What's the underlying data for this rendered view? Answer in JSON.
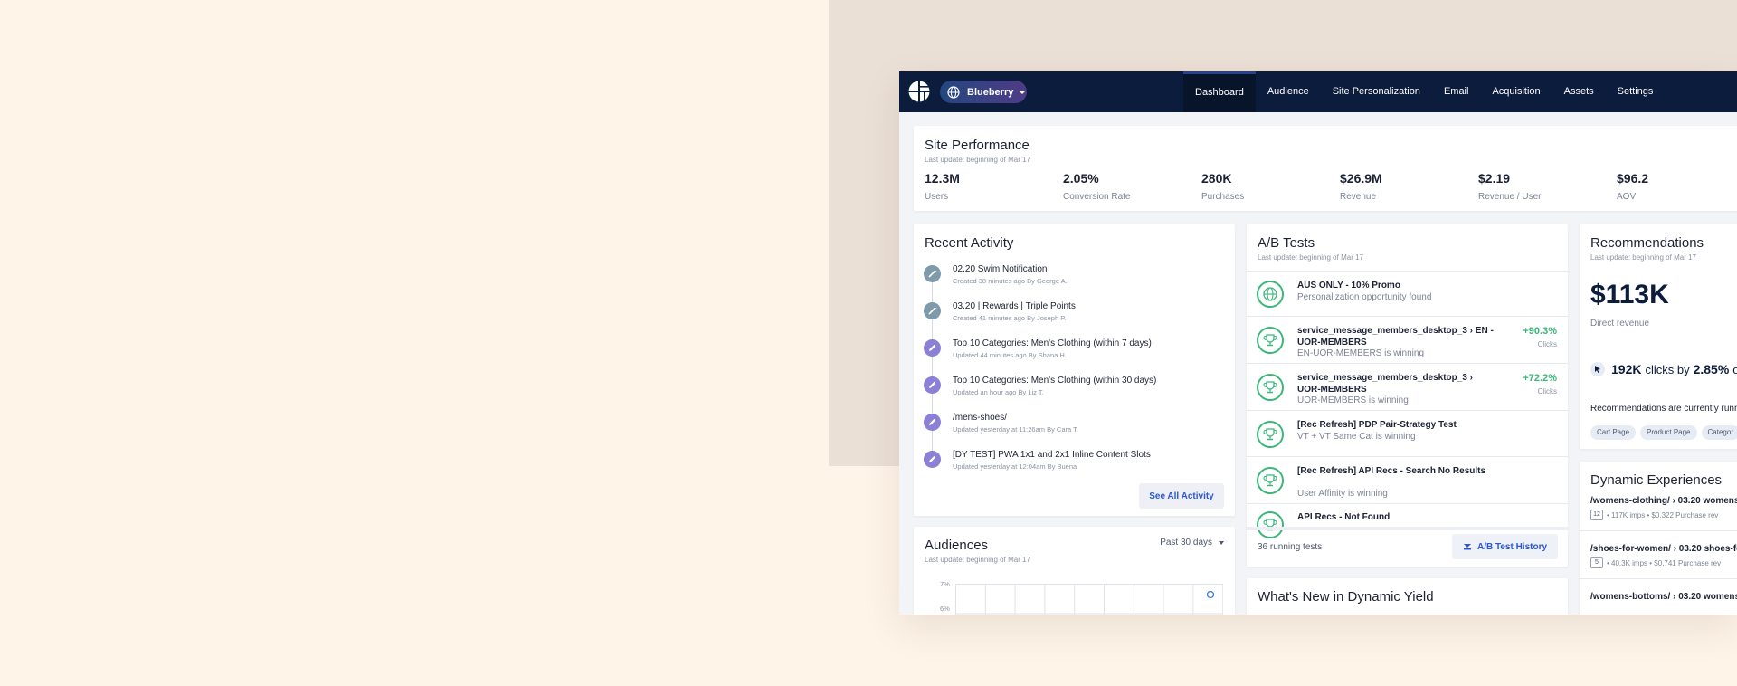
{
  "site": {
    "name": "Blueberry"
  },
  "nav": {
    "tabs": [
      "Dashboard",
      "Audience",
      "Site Personalization",
      "Email",
      "Acquisition",
      "Assets",
      "Settings"
    ],
    "active": "Dashboard"
  },
  "site_performance": {
    "title": "Site Performance",
    "updated": "Last update: beginning of Mar 17",
    "metrics": [
      {
        "value": "12.3M",
        "label": "Users"
      },
      {
        "value": "2.05%",
        "label": "Conversion Rate"
      },
      {
        "value": "280K",
        "label": "Purchases"
      },
      {
        "value": "$26.9M",
        "label": "Revenue"
      },
      {
        "value": "$2.19",
        "label": "Revenue / User"
      },
      {
        "value": "$96.2",
        "label": "AOV"
      }
    ]
  },
  "recent_activity": {
    "title": "Recent Activity",
    "items": [
      {
        "title": "02.20 Swim Notification",
        "meta": "Created 38 minutes ago By George A.",
        "kind": "created"
      },
      {
        "title": "03.20 | Rewards | Triple Points",
        "meta": "Created 41 minutes ago By Joseph P.",
        "kind": "created"
      },
      {
        "title": "Top 10 Categories: Men's Clothing (within 7 days)",
        "meta": "Updated 44 minutes ago By Shana H.",
        "kind": "updated"
      },
      {
        "title": "Top 10 Categories: Men's Clothing (within 30 days)",
        "meta": "Updated an hour ago By Liz T.",
        "kind": "updated"
      },
      {
        "title": "/mens-shoes/",
        "meta": "Updated yesterday at 11:26am By Cara T.",
        "kind": "updated"
      },
      {
        "title": "[DY TEST] PWA 1x1 and 2x1 Inline Content Slots",
        "meta": "Updated yesterday at 12:04am By Buena",
        "kind": "updated"
      }
    ],
    "see_all": "See All Activity",
    "colors": {
      "created": "#7f9aaa",
      "updated": "#8b7fd6"
    }
  },
  "audiences": {
    "title": "Audiences",
    "updated": "Last update: beginning of Mar 17",
    "range": "Past 30 days",
    "yticks": [
      "7%",
      "6%"
    ]
  },
  "ab_tests": {
    "title": "A/B Tests",
    "updated": "Last update: beginning of Mar 17",
    "items": [
      {
        "title": "AUS ONLY - 10% Promo",
        "status": "Personalization opportunity found",
        "pct": "",
        "metric": "",
        "icon": "globe-icon"
      },
      {
        "title": "service_message_members_desktop_3 › EN - UOR-MEMBERS",
        "status": "EN-UOR-MEMBERS is winning",
        "pct": "+90.3%",
        "metric": "Clicks",
        "icon": "trophy-icon"
      },
      {
        "title": "service_message_members_desktop_3 › UOR-MEMBERS",
        "status": "UOR-MEMBERS is winning",
        "pct": "+72.2%",
        "metric": "Clicks",
        "icon": "trophy-icon"
      },
      {
        "title": "[Rec Refresh] PDP Pair-Strategy Test",
        "status": "VT + VT Same Cat is winning",
        "pct": "",
        "metric": "",
        "icon": "trophy-icon"
      },
      {
        "title": "[Rec Refresh] API Recs - Search No Results",
        "status": "User Affinity is winning",
        "pct": "",
        "metric": "",
        "icon": "trophy-icon"
      },
      {
        "title": "API Recs - Not Found",
        "status": "",
        "pct": "",
        "metric": "",
        "icon": "trophy-icon"
      }
    ],
    "running": "36 running tests",
    "history_btn": "A/B Test History"
  },
  "whats_new": {
    "title": "What's New in Dynamic Yield"
  },
  "recommendations": {
    "title": "Recommendations",
    "updated": "Last update: beginning of Mar 17",
    "revenue": "$113K",
    "revenue_label": "Direct revenue",
    "clicks_value": "192K",
    "clicks_word": "clicks by",
    "clicks_pct": "2.85%",
    "clicks_tail": "o",
    "running_note": "Recommendations are currently runn",
    "chips": [
      "Cart Page",
      "Product Page",
      "Categor"
    ]
  },
  "dynamic_experiences": {
    "title": "Dynamic Experiences",
    "items": [
      {
        "title": "/womens-clothing/ › 03.20 womens",
        "count": "12",
        "stats": "• 117K imps • $0.322 Purchase rev"
      },
      {
        "title": "/shoes-for-women/ › 03.20 shoes-fo",
        "count": "5",
        "stats": "• 40.3K imps • $0.741 Purchase rev"
      },
      {
        "title": "/womens-bottoms/ › 03.20 womens",
        "count": "",
        "stats": ""
      }
    ]
  }
}
